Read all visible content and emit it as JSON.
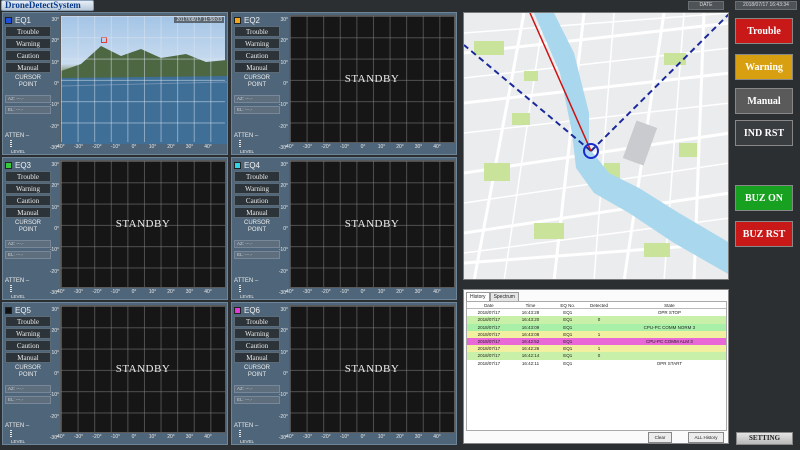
{
  "app": {
    "title": "DroneDetectSystem",
    "date_label": "DATE",
    "date_value": "2018/07/17 16:43:34"
  },
  "panel_buttons": {
    "trouble": "Trouble",
    "warning": "Warning",
    "caution": "Caution",
    "manual": "Manual",
    "cursor_point": "CURSOR\nPOINT",
    "az": "AZ: ---.-",
    "el": "EL: ---.-",
    "atten": "ATTEN –",
    "level": "LEVEL"
  },
  "axis": {
    "y_ticks": [
      "30°",
      "20°",
      "10°",
      "0°",
      "-10°",
      "-20°",
      "-30°"
    ],
    "x_ticks": [
      "-40°",
      "-30°",
      "-20°",
      "-10°",
      "0°",
      "10°",
      "20°",
      "30°",
      "40°"
    ]
  },
  "panels": [
    {
      "name": "EQ1",
      "color": "#1f4fe0",
      "mode": "camera",
      "timestamp": "2017/08/17 11:58:03",
      "standby": ""
    },
    {
      "name": "EQ2",
      "color": "#f2a81a",
      "mode": "standby",
      "timestamp": "",
      "standby": "STANDBY"
    },
    {
      "name": "EQ3",
      "color": "#37c93a",
      "mode": "standby",
      "timestamp": "",
      "standby": "STANDBY"
    },
    {
      "name": "EQ4",
      "color": "#30d5e6",
      "mode": "standby",
      "timestamp": "",
      "standby": "STANDBY"
    },
    {
      "name": "EQ5",
      "color": "#111111",
      "mode": "standby",
      "timestamp": "",
      "standby": "STANDBY"
    },
    {
      "name": "EQ6",
      "color": "#e23ad6",
      "mode": "standby",
      "timestamp": "",
      "standby": "STANDBY"
    }
  ],
  "history": {
    "tabs": [
      "History",
      "Spectrum"
    ],
    "columns": [
      "Date",
      "Time",
      "EQ No.",
      "Detected",
      "State"
    ],
    "rows": [
      {
        "date": "2018/07/17",
        "time": "16:43:28",
        "eq": "EQ1",
        "detected": "",
        "state": "OPR STOP",
        "color": "#ffffff"
      },
      {
        "date": "2018/07/17",
        "time": "16:43:20",
        "eq": "EQ1",
        "detected": "0",
        "state": "",
        "color": "#c8f0a8"
      },
      {
        "date": "2018/07/17",
        "time": "16:43:09",
        "eq": "EQ1",
        "detected": "",
        "state": "CPU-PC COMM NORM 3",
        "color": "#a8f0a8"
      },
      {
        "date": "2018/07/17",
        "time": "16:43:08",
        "eq": "EQ1",
        "detected": "1",
        "state": "",
        "color": "#f0f0a0"
      },
      {
        "date": "2018/07/17",
        "time": "16:42:52",
        "eq": "EQ1",
        "detected": "",
        "state": "CPU-PC COMM ALM 3",
        "color": "#e868d8"
      },
      {
        "date": "2018/07/17",
        "time": "16:42:26",
        "eq": "EQ1",
        "detected": "1",
        "state": "",
        "color": "#f0f0a0"
      },
      {
        "date": "2018/07/17",
        "time": "16:42:14",
        "eq": "EQ1",
        "detected": "0",
        "state": "",
        "color": "#c8f0a8"
      },
      {
        "date": "2018/07/17",
        "time": "16:42:11",
        "eq": "EQ1",
        "detected": "",
        "state": "OPR START",
        "color": "#ffffff"
      }
    ],
    "clear_label": "Clear",
    "all_history_label": "ALL History"
  },
  "side_buttons": [
    {
      "label": "Trouble",
      "color": "#c81818"
    },
    {
      "label": "Warning",
      "color": "#d8a010"
    },
    {
      "label": "Manual",
      "color": "#5a5a5a"
    },
    {
      "label": "IND RST",
      "color": "#3a3d40"
    },
    {
      "label": "BUZ ON",
      "color": "#18a020"
    },
    {
      "label": "BUZ RST",
      "color": "#c81818"
    }
  ],
  "setting_label": "SETTING"
}
